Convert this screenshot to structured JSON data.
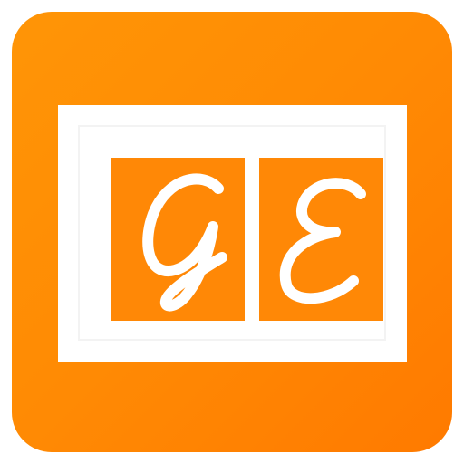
{
  "app_icon": {
    "letters": [
      "G",
      "E"
    ],
    "colors": {
      "tile": "#ff8a04",
      "frame": "#ffffff",
      "letter_boxes": "#ff8806",
      "letters": "#ffffff"
    },
    "icon": "photo-frame-monogram-icon"
  }
}
